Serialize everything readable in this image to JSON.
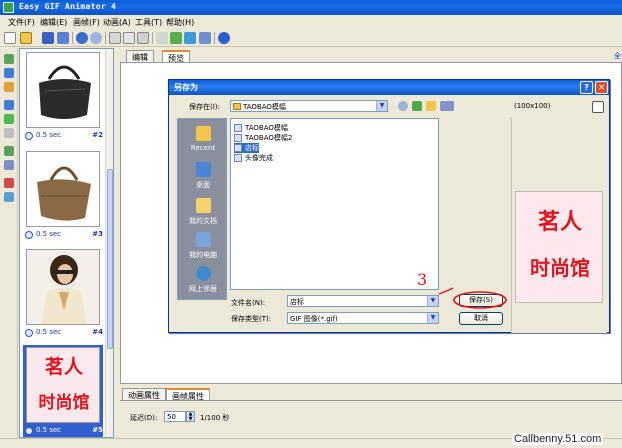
{
  "window": {
    "title": "Easy GIF Animator 4"
  },
  "menu": [
    "文件(F)",
    "编辑(E)",
    "画帧(F)",
    "动画(A)",
    "工具(T)",
    "帮助(H)"
  ],
  "tabs": {
    "edit": "编辑",
    "preview": "预览",
    "corner": "全"
  },
  "frames": [
    {
      "delay": "0.5 sec",
      "num": "#2",
      "kind": "black-bag"
    },
    {
      "delay": "0.5 sec",
      "num": "#3",
      "kind": "brown-bag"
    },
    {
      "delay": "0.5 sec",
      "num": "#4",
      "kind": "woman"
    },
    {
      "delay": "0.5 sec",
      "num": "#5",
      "kind": "logo"
    }
  ],
  "logo": {
    "line1": "茗人",
    "line2": "时尚馆"
  },
  "dialog": {
    "title": "另存为",
    "save_in_label": "保存在(I):",
    "save_in_value": "TAOBAO模幅",
    "places": [
      "Recent",
      "桌面",
      "我的文档",
      "我的电脑",
      "网上邻居"
    ],
    "files": [
      "TAOBAO模幅",
      "TAOBAO模幅2",
      "店标",
      "头像完成"
    ],
    "selected_index": 2,
    "preview_size": "(100x100)",
    "filename_label": "文件名(N):",
    "filename_value": "店标",
    "filetype_label": "保存类型(T):",
    "filetype_value": "GIF 图像(*.gif)",
    "save_button": "保存(S)",
    "cancel_button": "取消",
    "annotation": "3"
  },
  "bottom_tabs": {
    "anim": "动画属性",
    "frame": "画帧属性"
  },
  "props": {
    "delay_label": "延迟(D):",
    "delay_value": "50",
    "delay_unit": "1/100 秒"
  },
  "watermark": "Callbenny.51.com"
}
